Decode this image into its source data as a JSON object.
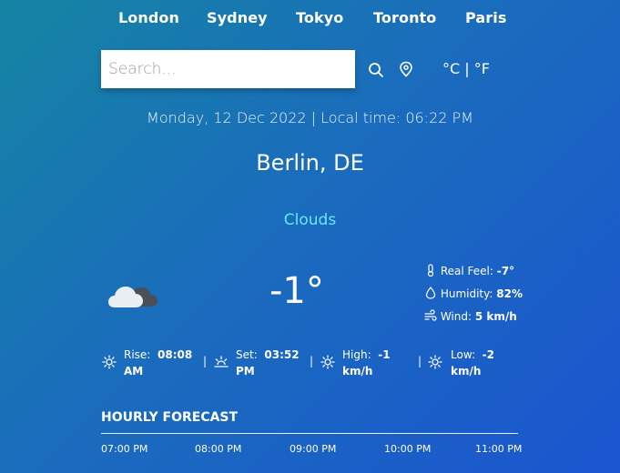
{
  "top_cities": [
    "London",
    "Sydney",
    "Tokyo",
    "Toronto",
    "Paris"
  ],
  "search": {
    "placeholder": "Search..."
  },
  "units": {
    "celsius": "°C",
    "separator": "|",
    "fahrenheit": "°F"
  },
  "datetime": "Monday, 12 Dec 2022 | Local time: 06:22 PM",
  "location": "Berlin, DE",
  "condition": "Clouds",
  "temperature": "-1°",
  "details": {
    "real_feel_label": "Real Feel:",
    "real_feel_value": "-7°",
    "humidity_label": "Humidity:",
    "humidity_value": "82%",
    "wind_label": "Wind:",
    "wind_value": "5 km/h"
  },
  "sun": {
    "rise_label": "Rise:",
    "rise_value": "08:08",
    "rise_suffix": "AM",
    "set_label": "Set:",
    "set_value": "03:52",
    "set_suffix": "PM",
    "high_label": "High:",
    "high_value": "-1",
    "high_suffix": "km/h",
    "low_label": "Low:",
    "low_value": "-2",
    "low_suffix": "km/h",
    "separator": "|"
  },
  "hourly": {
    "title": "HOURLY FORECAST",
    "times": [
      "07:00 PM",
      "08:00 PM",
      "09:00 PM",
      "10:00 PM",
      "11:00 PM"
    ]
  },
  "icons": {
    "search": "search-icon",
    "location": "location-pin-icon",
    "weather": "clouds-icon"
  }
}
